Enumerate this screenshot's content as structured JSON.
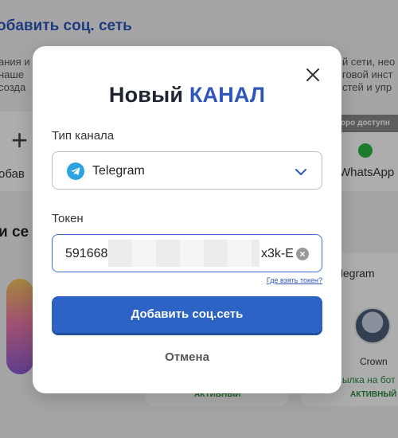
{
  "background": {
    "title": "обавить соц. сеть",
    "left_text": [
      "ания и",
      "наше",
      "созда"
    ],
    "right_text": [
      "й сети, нео",
      "говой инст",
      "стей и упр"
    ],
    "add_label": "обав",
    "badge": "оро доступн",
    "whatsapp_label": "WhatsApp",
    "section_title": "и се",
    "telegram_label": "elegram",
    "crown_label": "Crown",
    "bot_link": "сылка на бот",
    "active_label_1": "АКТИВНЫЙ",
    "active_label_2": "АКТИВНЫЙ"
  },
  "modal": {
    "title_part1": "Новый",
    "title_part2": "КАНАЛ",
    "channel_type_label": "Тип канала",
    "channel_type_value": "Telegram",
    "token_label": "Токен",
    "token_prefix": "591668",
    "token_suffix": "x3k-E",
    "help_link": "Где взять токен?",
    "submit_label": "Добавить соц.сеть",
    "cancel_label": "Отмена"
  },
  "colors": {
    "accent": "#2f56b8",
    "primary_button": "#2d63c4",
    "telegram": "#2aa3e0",
    "whatsapp": "#2bb741",
    "active_green": "#2b8a3e"
  },
  "icons": {
    "close": "close-icon",
    "telegram": "telegram-icon",
    "chevron": "chevron-down-icon",
    "clear": "clear-icon"
  }
}
